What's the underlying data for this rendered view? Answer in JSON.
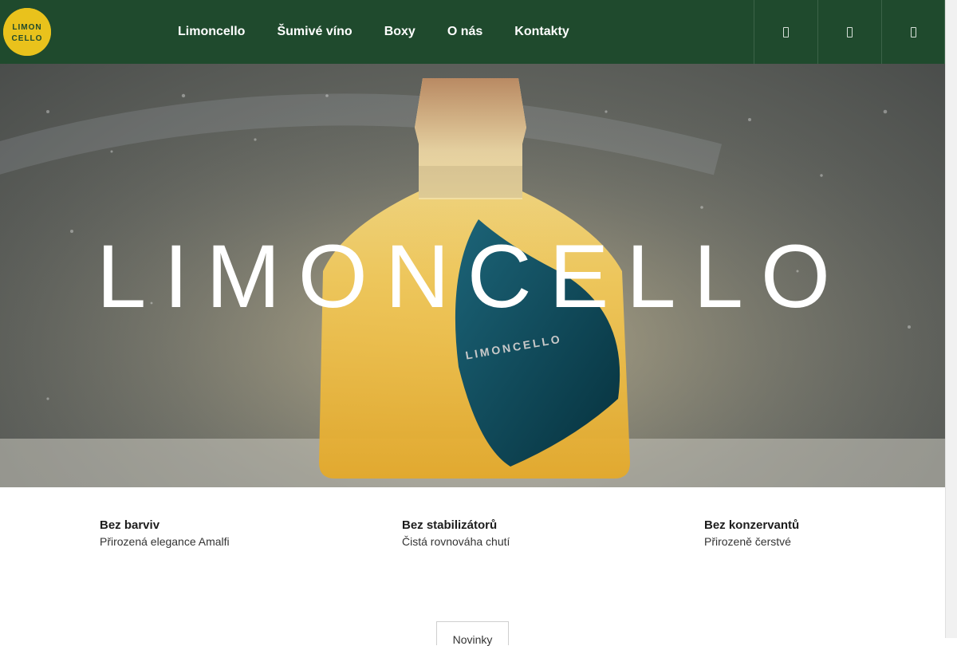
{
  "brand": {
    "logo_lines": [
      "LIMON",
      "CELLO"
    ],
    "colors": {
      "header": "#1f4a2d",
      "logo": "#e9c21c",
      "accent": "#0c4a5a"
    }
  },
  "nav": {
    "items": [
      "Limoncello",
      "Šumivé víno",
      "Boxy",
      "O nás",
      "Kontakty"
    ]
  },
  "header_icons": [
    "search-icon",
    "user-icon",
    "cart-icon"
  ],
  "hero": {
    "wordmark": "LIMONCELLO",
    "tag_text": "LIMONCELLO"
  },
  "features": [
    {
      "title": "Bez barviv",
      "subtitle": "Přirozená elegance Amalfi"
    },
    {
      "title": "Bez stabilizátorů",
      "subtitle": "Čistá rovnováha chutí"
    },
    {
      "title": "Bez konzervantů",
      "subtitle": "Přirozeně čerstvé"
    }
  ],
  "news_button": {
    "label": "Novinky"
  }
}
